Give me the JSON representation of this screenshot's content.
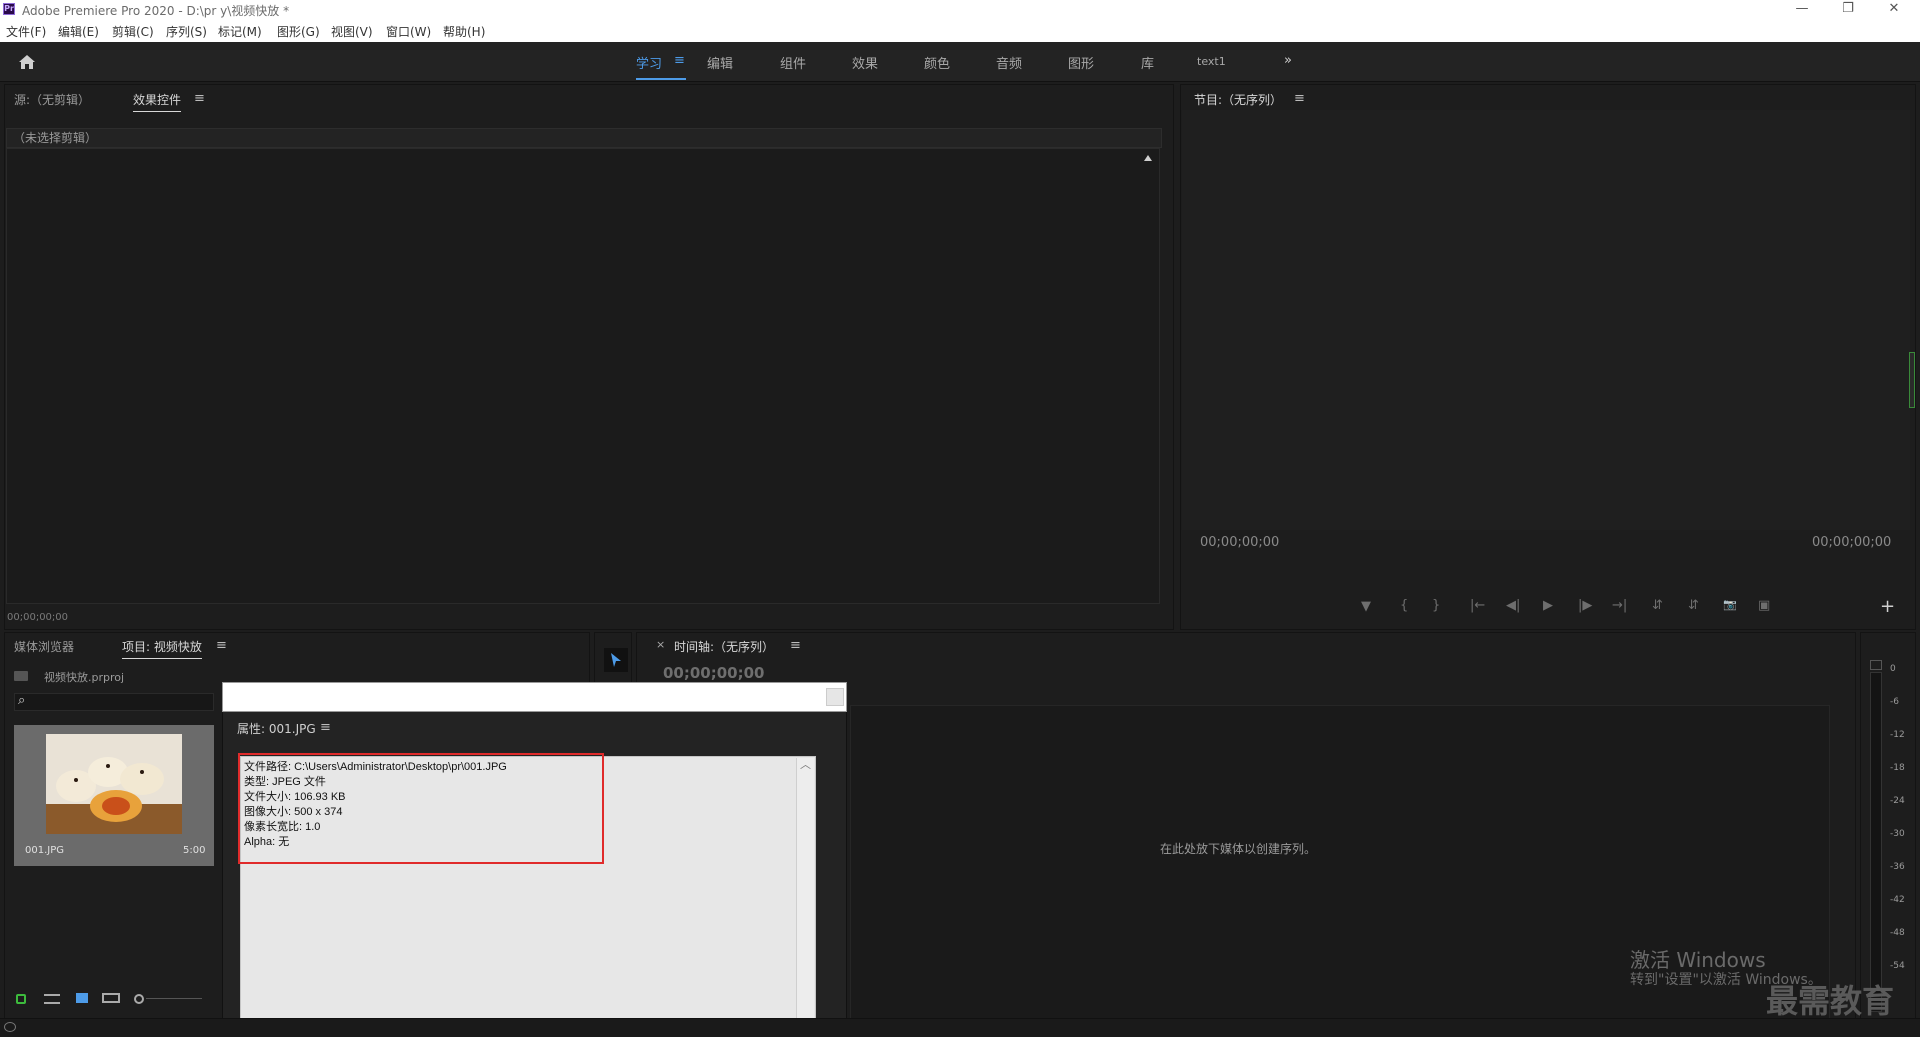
{
  "window": {
    "title": "Adobe Premiere Pro 2020 - D:\\pr y\\视频快放 *",
    "app_icon_text": "Pr",
    "minimize": "—",
    "maximize": "❐",
    "close": "✕"
  },
  "menu": [
    "文件(F)",
    "编辑(E)",
    "剪辑(C)",
    "序列(S)",
    "标记(M)",
    "图形(G)",
    "视图(V)",
    "窗口(W)",
    "帮助(H)"
  ],
  "workspaces": {
    "items": [
      "学习",
      "编辑",
      "组件",
      "效果",
      "颜色",
      "音频",
      "图形",
      "库",
      "text1"
    ],
    "menu_glyph": "≡",
    "more": "»"
  },
  "source_panel": {
    "tab_source": "源:（无剪辑）",
    "tab_effects": "效果控件",
    "menu_glyph": "≡",
    "no_clip": "（未选择剪辑）",
    "timecode": "00;00;00;00"
  },
  "program_panel": {
    "title": "节目:（无序列）",
    "menu_glyph": "≡",
    "timecode_left": "00;00;00;00",
    "timecode_right": "00;00;00;00",
    "controls": [
      "▼",
      "{",
      "}",
      "|←",
      "◀|",
      "▶",
      "|▶",
      "→|",
      "⇵",
      "⇵",
      "📷",
      "▣"
    ],
    "add": "+"
  },
  "project_panel": {
    "tab_media_browser": "媒体浏览器",
    "tab_project": "项目: 视频快放",
    "menu_glyph": "≡",
    "project_file": "视频快放.prproj",
    "search_icon": "⌕",
    "clip": {
      "name": "001.JPG",
      "duration": "5:00"
    }
  },
  "timeline_panel": {
    "close": "×",
    "title": "时间轴:（无序列）",
    "menu_glyph": "≡",
    "timecode": "00;00;00;00",
    "drop_hint": "在此处放下媒体以创建序列。"
  },
  "audio_meter": {
    "ticks": [
      "0",
      "-6",
      "-12",
      "-18",
      "-24",
      "-30",
      "-36",
      "-42",
      "-48",
      "-54"
    ]
  },
  "properties_dialog": {
    "title": "属性: 001.JPG",
    "menu_glyph": "≡",
    "lines": [
      "文件路径: C:\\Users\\Administrator\\Desktop\\pr\\001.JPG",
      "类型: JPEG 文件",
      "文件大小: 106.93 KB",
      "图像大小: 500 x 374",
      "像素长宽比: 1.0",
      "Alpha: 无"
    ],
    "scroll_up": "︿"
  },
  "watermark": {
    "activate_title": "激活 Windows",
    "activate_sub": "转到\"设置\"以激活 Windows。",
    "brand": "最需教育"
  },
  "colors": {
    "accent": "#4d9be8",
    "highlight": "#e02b2b"
  }
}
